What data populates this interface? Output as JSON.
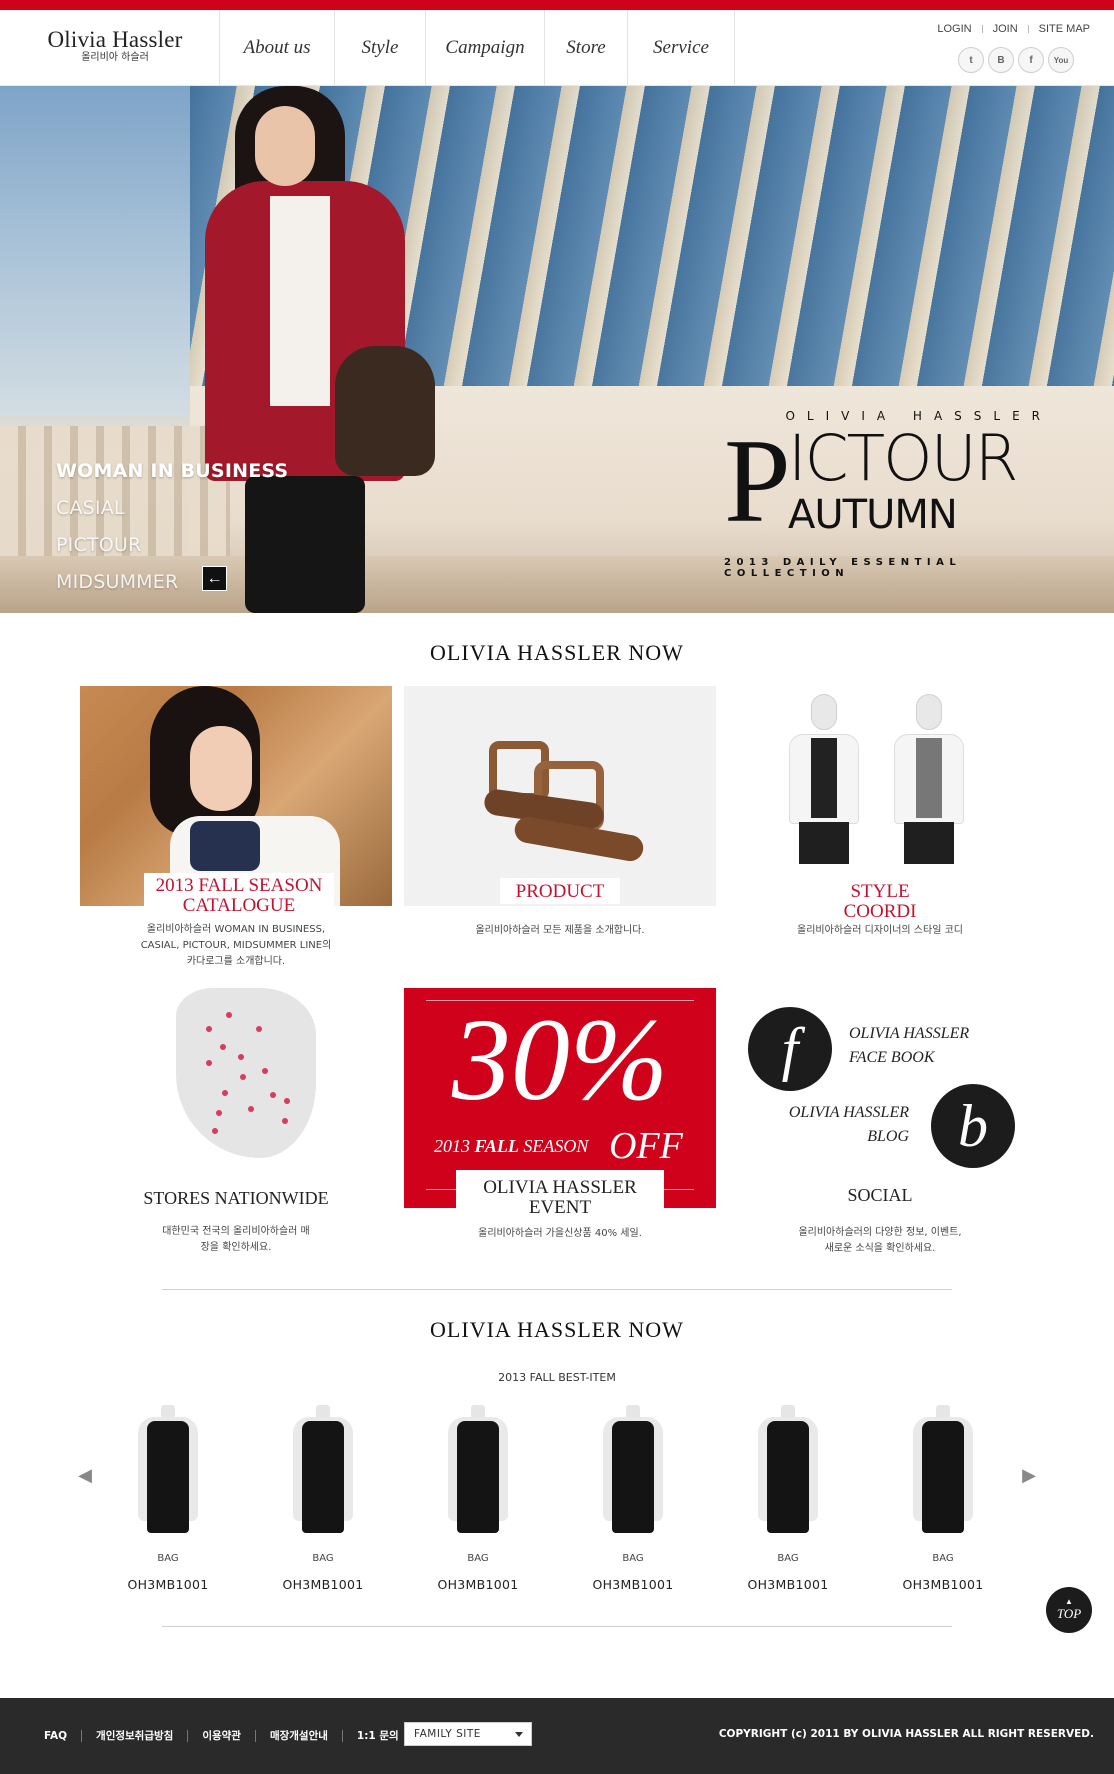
{
  "header": {
    "logo": {
      "name": "Olivia Hassler",
      "sub": "올리비아 하슬러"
    },
    "nav": [
      "About us",
      "Style",
      "Campaign",
      "Store",
      "Service"
    ],
    "util": {
      "login": "LOGIN",
      "join": "JOIN",
      "sitemap": "SITE MAP"
    },
    "sns": [
      {
        "icon": "twitter-icon",
        "glyph": "t"
      },
      {
        "icon": "blog-icon",
        "glyph": "B"
      },
      {
        "icon": "facebook-icon",
        "glyph": "f"
      },
      {
        "icon": "youtube-icon",
        "glyph": "You"
      }
    ]
  },
  "hero": {
    "menu": [
      "WOMAN IN BUSINESS",
      "CASIAL",
      "PICTOUR",
      "MIDSUMMER"
    ],
    "active_index": 0,
    "kicker": "OLIVIA HASSLER",
    "big_initial": "P",
    "line1": "ICTOUR",
    "line2": "AUTUMN",
    "sub": "2013 DAILY ESSENTIAL COLLECTION",
    "arrow": "←"
  },
  "now": {
    "title": "OLIVIA HASSLER NOW",
    "cards": [
      {
        "label": "2013 FALL SEASON CATALOGUE",
        "desc": "올리비아하슬러 WOMAN IN BUSINESS, CASIAL, PICTOUR, MIDSUMMER LINE의 카다로그를 소개합니다."
      },
      {
        "label": "PRODUCT",
        "desc": "올리비아하슬러 모든 제품을 소개합니다."
      },
      {
        "label": "STYLE COORDI",
        "desc": "올리비아하슬러 디자이너의 스타일 코디"
      }
    ],
    "stores": {
      "label": "STORES NATIONWIDE",
      "desc": "대한민국 전국의 올리비아하슬러 매장을 확인하세요."
    },
    "event": {
      "percent": "30%",
      "season_pre": "2013 ",
      "season_bold": "FALL",
      "season_post": " SEASON",
      "off": "OFF",
      "label": "OLIVIA HASSLER EVENT",
      "desc": "올리비아하슬러 가을신상품 40% 세일."
    },
    "social": {
      "facebook_glyph": "f",
      "facebook_text": "OLIVIA HASSLER FACE BOOK",
      "blog_glyph": "b",
      "blog_text": "OLIVIA HASSLER BLOG",
      "label": "SOCIAL",
      "desc": "올리비아하슬러의 다양한 정보, 이벤트, 새로운 소식을 확인하세요."
    }
  },
  "best": {
    "title": "OLIVIA HASSLER NOW",
    "subtitle": "2013 FALL BEST-ITEM",
    "items": [
      {
        "category": "BAG",
        "code": "OH3MB1001"
      },
      {
        "category": "BAG",
        "code": "OH3MB1001"
      },
      {
        "category": "BAG",
        "code": "OH3MB1001"
      },
      {
        "category": "BAG",
        "code": "OH3MB1001"
      },
      {
        "category": "BAG",
        "code": "OH3MB1001"
      },
      {
        "category": "BAG",
        "code": "OH3MB1001"
      }
    ],
    "prev": "◀",
    "next": "▶"
  },
  "top_button": {
    "arrow": "▲",
    "label": "TOP"
  },
  "footer": {
    "links": [
      "FAQ",
      "개인정보취급방침",
      "이용약관",
      "매장개설안내",
      "1:1 문의"
    ],
    "family_site": "FAMILY SITE",
    "copyright": "COPYRIGHT (c) 2011 BY OLIVIA HASSLER ALL RIGHT RESERVED."
  },
  "colors": {
    "brand_red": "#d0021b",
    "label_red": "#c8102e",
    "footer_bg": "#2a2a2a"
  }
}
